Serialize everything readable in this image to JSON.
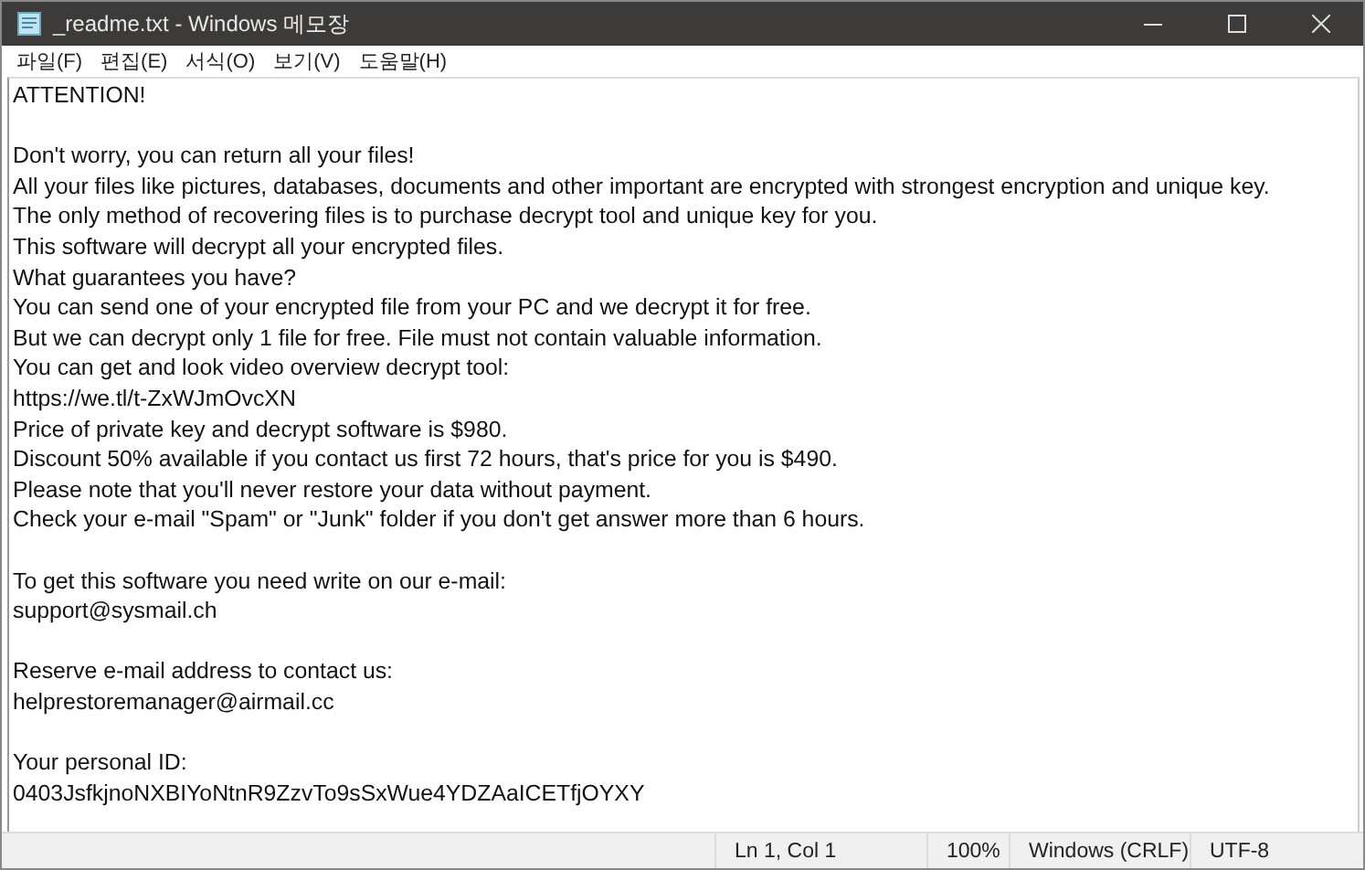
{
  "window": {
    "title": "_readme.txt - Windows 메모장"
  },
  "menu": [
    "파일(F)",
    "편집(E)",
    "서식(O)",
    "보기(V)",
    "도움말(H)"
  ],
  "document": {
    "blocks": [
      {
        "extra_gap": false,
        "lines": [
          "ATTENTION!"
        ]
      },
      {
        "extra_gap": false,
        "lines": [
          "Don't worry, you can return all your files!",
          "All your files like pictures, databases, documents and other important are encrypted with strongest encryption and unique key.",
          "The only method of recovering files is to purchase decrypt tool and unique key for you.",
          "This software will decrypt all your encrypted files.",
          "What guarantees you have?",
          "You can send one of your encrypted file from your PC and we decrypt it for free.",
          "But we can decrypt only 1 file for free. File must not contain valuable information.",
          "You can get and look video overview decrypt tool:",
          "https://we.tl/t-ZxWJmOvcXN",
          "Price of private key and decrypt software is $980.",
          "Discount 50% available if you contact us first 72 hours, that's price for you is $490.",
          "Please note that you'll never restore your data without payment.",
          "Check your e-mail \"Spam\" or \"Junk\" folder if you don't get answer more than 6 hours."
        ]
      },
      {
        "extra_gap": true,
        "lines": [
          "To get this software you need write on our e-mail:",
          "support@sysmail.ch"
        ]
      },
      {
        "extra_gap": false,
        "lines": [
          "Reserve e-mail address to contact us:",
          "helprestoremanager@airmail.cc"
        ]
      },
      {
        "extra_gap": false,
        "lines": [
          "Your personal ID:",
          "0403JsfkjnoNXBIYoNtnR9ZzvTo9sSxWue4YDZAaICETfjOYXY"
        ]
      }
    ]
  },
  "status_bar": [
    "Ln 1, Col 1",
    "100%",
    "Windows (CRLF)",
    "UTF-8"
  ]
}
